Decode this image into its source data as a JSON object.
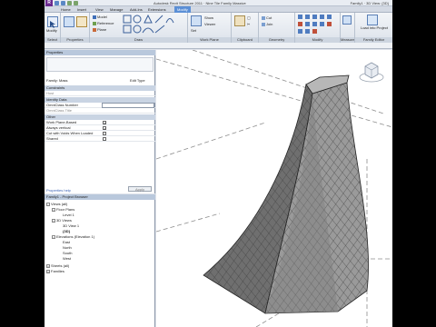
{
  "title": {
    "app_letter": "R",
    "text": "Autodesk Revit Structure 2011 · Nine Tile Family Massive",
    "search_text": "Family1 · 3D View: {3D}"
  },
  "tabs": [
    {
      "label": "Home"
    },
    {
      "label": "Insert"
    },
    {
      "label": "View"
    },
    {
      "label": "Manage"
    },
    {
      "label": "Add-Ins"
    },
    {
      "label": "Extensions"
    },
    {
      "label": "Modify"
    }
  ],
  "ribbon": {
    "groups": [
      {
        "label": "Select"
      },
      {
        "label": "Properties"
      },
      {
        "label": "Draw"
      },
      {
        "label": "Work Plane"
      },
      {
        "label": "Clipboard"
      },
      {
        "label": "Geometry"
      },
      {
        "label": "Modify"
      },
      {
        "label": "Measure"
      },
      {
        "label": "Family Editor"
      }
    ],
    "modify_label": "Modify",
    "draw_items": [
      "Model",
      "Reference",
      "Plane"
    ],
    "workplane_items": [
      "Set",
      "Show",
      "Viewer"
    ],
    "clipboard_items": [
      "Cut",
      "Join"
    ],
    "load_label": "Load into Project"
  },
  "properties": {
    "header": "Properties",
    "type_name": "Family: Mass",
    "edit_type": "Edit Type",
    "sections": {
      "constraints": "Constraints",
      "identity": "Identity Data",
      "other": "Other"
    },
    "rows": {
      "host": "Host",
      "omniclass_number": "OmniClass Number",
      "omniclass_title": "OmniClass Title",
      "work_plane_based": "Work Plane-Based",
      "always_vertical": "Always vertical",
      "cut_with_voids": "Cut with Voids When Loaded",
      "shared": "Shared"
    },
    "help_link": "Properties help",
    "apply": "Apply"
  },
  "browser": {
    "header": "Family1 - Project Browser",
    "tree": [
      {
        "label": "Views (all)",
        "sign": "−"
      },
      {
        "label": "Floor Plans",
        "sign": "−"
      },
      {
        "label": "Level 1",
        "sign": ""
      },
      {
        "label": "3D Views",
        "sign": "−"
      },
      {
        "label": "3D View 1",
        "sign": ""
      },
      {
        "label": "{3D}",
        "sign": ""
      },
      {
        "label": "Elevations (Elevation 1)",
        "sign": "−"
      },
      {
        "label": "East",
        "sign": ""
      },
      {
        "label": "North",
        "sign": ""
      },
      {
        "label": "South",
        "sign": ""
      },
      {
        "label": "West",
        "sign": ""
      },
      {
        "label": "Sheets (all)",
        "sign": "+"
      },
      {
        "label": "Families",
        "sign": "+"
      }
    ]
  },
  "colors": {
    "accent": "#5b8fd6",
    "mass_face": "#9a9a9a",
    "mass_dark": "#6f6f6f",
    "mass_top": "#b7b7b7"
  }
}
